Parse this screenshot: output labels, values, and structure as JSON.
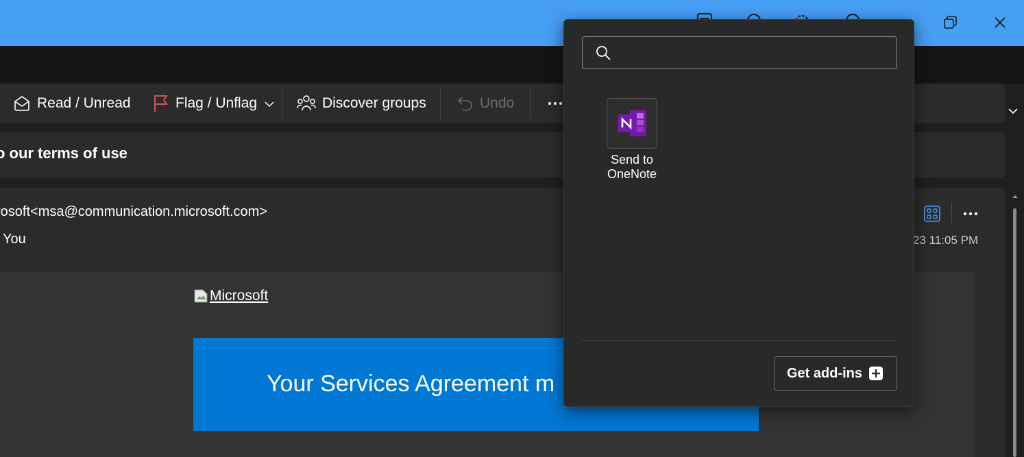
{
  "colors": {
    "titlebar": "#479ef5",
    "background": "#1f1f1f",
    "panel": "#2b2b2b",
    "banner": "#0078d4",
    "flag_accent": "#e05a5a",
    "apps_icon_accent": "#479ef5",
    "onenote_purple": "#7719aa"
  },
  "titlebar": {
    "icons": [
      "notes-icon",
      "lightbulb-icon",
      "gear-icon",
      "help-icon",
      "restore-window-icon",
      "close-icon"
    ]
  },
  "ribbon": {
    "read_unread": "Read / Unread",
    "flag_unflag": "Flag / Unflag",
    "discover_groups": "Discover groups",
    "undo": "Undo"
  },
  "subject": {
    "text": "o our terms of use"
  },
  "message": {
    "sender": "rosoft<msa@communication.microsoft.com>",
    "to": "You",
    "date": "23 11:05 PM"
  },
  "email_body": {
    "logo_link": "Microsoft",
    "banner_text": "Your Services Agreement m"
  },
  "addins_popup": {
    "search_placeholder": "",
    "items": [
      {
        "label_line1": "Send to",
        "label_line2": "OneNote",
        "icon": "onenote-icon"
      }
    ],
    "get_addins": "Get add-ins"
  }
}
